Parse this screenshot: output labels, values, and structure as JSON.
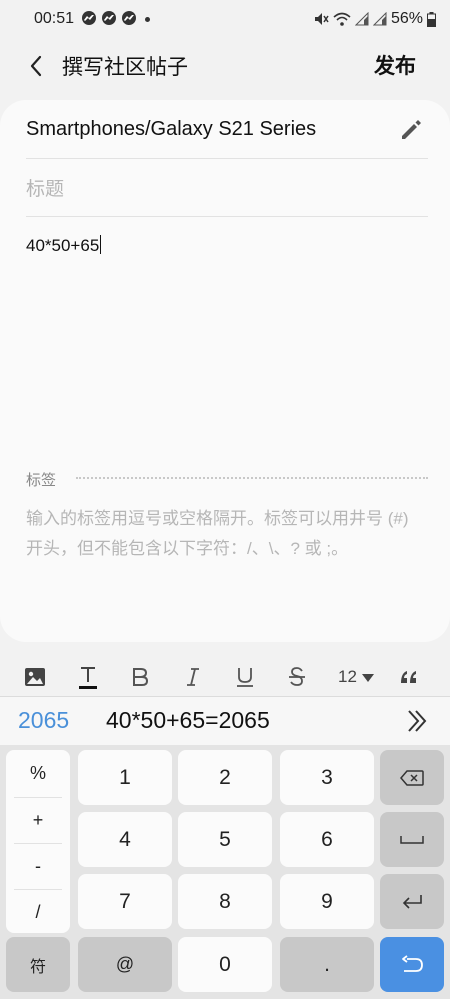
{
  "status_bar": {
    "time": "00:51",
    "battery": "56%"
  },
  "header": {
    "title": "撰写社区帖子",
    "publish_label": "发布"
  },
  "editor": {
    "category": "Smartphones/Galaxy S21 Series",
    "title_placeholder": "标题",
    "body_text": "40*50+65",
    "tags_label": "标签",
    "tags_hint": "输入的标签用逗号或空格隔开。标签可以用井号 (#) 开头，但不能包含以下字符：/、\\、? 或 ;。"
  },
  "format_toolbar": {
    "font_size": "12"
  },
  "calc_bar": {
    "result": "2065",
    "expression": "40*50+65=2065"
  },
  "keyboard": {
    "symbols": [
      "%",
      "+",
      "-",
      "/"
    ],
    "digits": [
      "1",
      "2",
      "3",
      "4",
      "5",
      "6",
      "7",
      "8",
      "9",
      "0"
    ],
    "symbol_key": "符",
    "at_key": "@",
    "dot_key": "."
  },
  "colors": {
    "accent": "#4a90d9",
    "keyboard_bg": "#e4e4e4",
    "enter_key": "#4a90e2"
  }
}
